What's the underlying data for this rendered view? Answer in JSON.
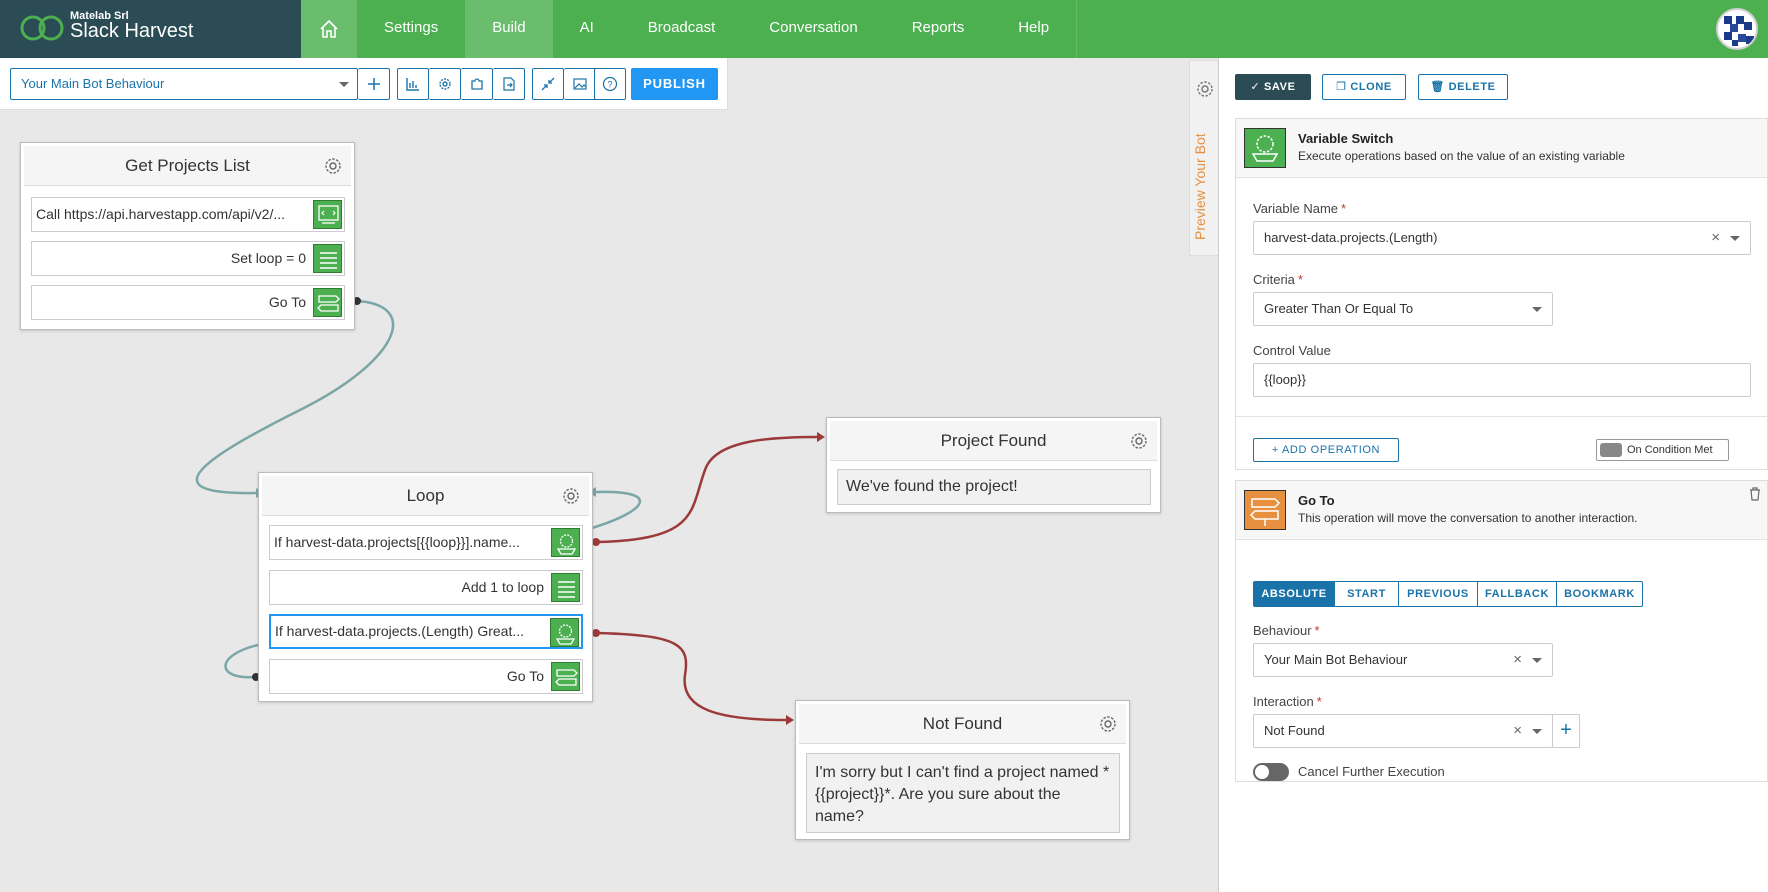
{
  "brand": {
    "company": "Matelab Srl",
    "app": "Slack Harvest"
  },
  "nav": {
    "items": [
      "Settings",
      "Build",
      "AI",
      "Broadcast",
      "Conversation",
      "Reports",
      "Help"
    ],
    "active": "Build"
  },
  "toolbar": {
    "behaviour": "Your Main Bot Behaviour",
    "publish": "PUBLISH"
  },
  "nodes": {
    "get_projects": {
      "title": "Get Projects List",
      "ops": [
        "Call https://api.harvestapp.com/api/v2/...",
        "Set loop = 0",
        "Go To"
      ]
    },
    "loop": {
      "title": "Loop",
      "ops": [
        "If harvest-data.projects[{{loop}}].name...",
        "Add 1 to loop",
        "If harvest-data.projects.(Length) Great...",
        "Go To"
      ]
    },
    "project_found": {
      "title": "Project Found",
      "message": "We've found the project!"
    },
    "not_found": {
      "title": "Not Found",
      "message": "I'm sorry but I can't find a project named *{{project}}*. Are you sure about the name?"
    }
  },
  "panel": {
    "side_tab": "Preview Your Bot",
    "buttons": {
      "save": "SAVE",
      "clone": "CLONE",
      "delete": "DELETE"
    },
    "variable_switch": {
      "title": "Variable Switch",
      "description": "Execute operations based on the value of an existing variable",
      "variable_name_label": "Variable Name",
      "variable_name": "harvest-data.projects.(Length)",
      "criteria_label": "Criteria",
      "criteria": "Greater Than Or Equal To",
      "control_value_label": "Control Value",
      "control_value": "{{loop}}",
      "add_operation": "ADD OPERATION",
      "on_condition": "On Condition Met"
    },
    "goto": {
      "title": "Go To",
      "description": "This operation will move the conversation to another interaction.",
      "tabs": [
        "ABSOLUTE",
        "START",
        "PREVIOUS",
        "FALLBACK",
        "BOOKMARK"
      ],
      "active_tab": "ABSOLUTE",
      "behaviour_label": "Behaviour",
      "behaviour": "Your Main Bot Behaviour",
      "interaction_label": "Interaction",
      "interaction": "Not Found",
      "cancel_label": "Cancel Further Execution",
      "cancel_enabled": false
    }
  },
  "colors": {
    "nav": "#4caf50",
    "brand": "#2b4b55",
    "accent": "#1a73a8",
    "publish": "#2196f3",
    "op_icon": "#4caf50",
    "goto_icon": "#e69040",
    "link_teal": "#7ba6a6",
    "link_red": "#9c3a3a"
  }
}
